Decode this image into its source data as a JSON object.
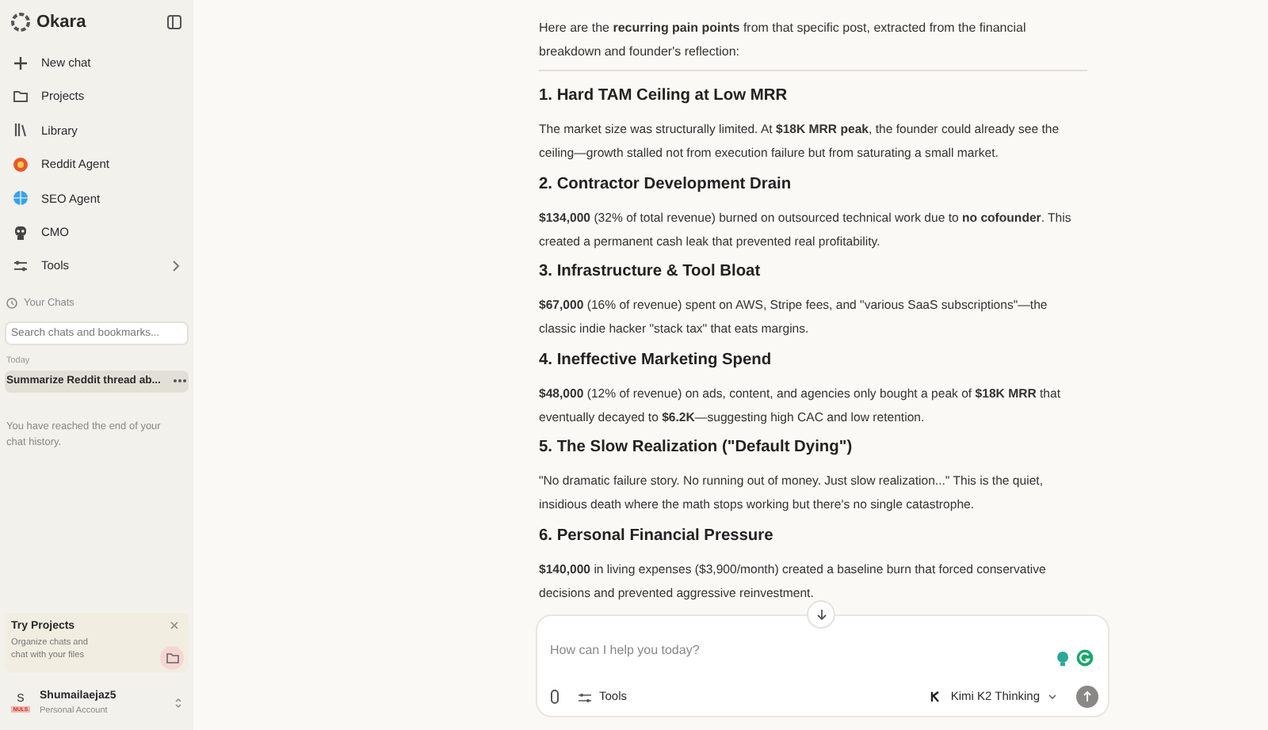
{
  "sidebar": {
    "brand": "Okara",
    "nav": [
      {
        "label": "New chat"
      },
      {
        "label": "Projects"
      },
      {
        "label": "Library"
      },
      {
        "label": "Reddit Agent"
      },
      {
        "label": "SEO Agent"
      },
      {
        "label": "CMO"
      },
      {
        "label": "Tools",
        "has_submenu": true
      }
    ],
    "chats_heading": "Your Chats",
    "search": {
      "placeholder": "Search chats and bookmarks..."
    },
    "groups": [
      {
        "label": "Today",
        "chats": [
          {
            "title": "Summarize Reddit thread ab...",
            "selected": true
          }
        ]
      }
    ],
    "end_note": "You have reached the end of your chat history.",
    "promo": {
      "title": "Try Projects",
      "text": "Organize chats and chat with your files"
    },
    "account": {
      "initial": "S",
      "badge": "NULS",
      "name": "Shumailaejaz5",
      "plan": "Personal Account"
    }
  },
  "message": {
    "intro": "Here are the **recurring pain points** from that specific post, extracted from the financial breakdown and founder's reflection:",
    "sections": [
      {
        "heading": "1. Hard TAM Ceiling at Low MRR",
        "text": "The market size was structurally limited. At **$18K MRR peak**, the founder could already see the ceiling—growth stalled not from execution failure but from saturating a small market."
      },
      {
        "heading": "2. Contractor Development Drain",
        "text": "**$134,000** (32% of total revenue) burned on outsourced technical work due to **no cofounder**. This created a permanent cash leak that prevented real profitability."
      },
      {
        "heading": "3. Infrastructure & Tool Bloat",
        "text": "**$67,000** (16% of revenue) spent on AWS, Stripe fees, and \"various SaaS subscriptions\"—the classic indie hacker \"stack tax\" that eats margins."
      },
      {
        "heading": "4. Ineffective Marketing Spend",
        "text": "**$48,000** (12% of revenue) on ads, content, and agencies only bought a peak of **$18K MRR** that eventually decayed to **$6.2K**—suggesting high CAC and low retention."
      },
      {
        "heading": "5. The Slow Realization (\"Default Dying\")",
        "text": "\"No dramatic failure story. No running out of money. Just slow realization...\" This is the quiet, insidious death where the math stops working but there's no single catastrophe."
      },
      {
        "heading": "6. Personal Financial Pressure",
        "text": "**$140,000** in living expenses ($3,900/month) created a baseline burn that forced conservative decisions and prevented aggressive reinvestment."
      }
    ]
  },
  "composer": {
    "placeholder": "How can I help you today?",
    "tools": "Tools",
    "model": "Kimi K2 Thinking"
  }
}
